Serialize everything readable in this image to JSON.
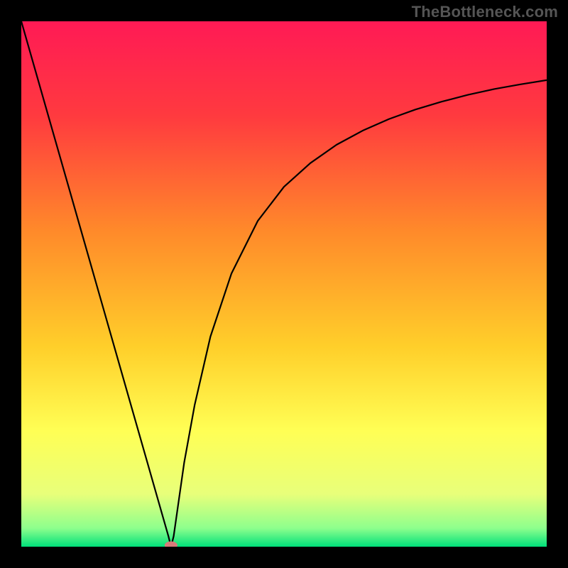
{
  "watermark": "TheBottleneck.com",
  "chart_data": {
    "type": "line",
    "title": "",
    "xlabel": "",
    "ylabel": "",
    "xlim": [
      0,
      100
    ],
    "ylim": [
      0,
      100
    ],
    "grid": false,
    "series": [
      {
        "name": "bottleneck-curve",
        "x": [
          0,
          3,
          6,
          9,
          12,
          15,
          18,
          21,
          24,
          26,
          27,
          28,
          28.5,
          29,
          30,
          31,
          33,
          36,
          40,
          45,
          50,
          55,
          60,
          65,
          70,
          75,
          80,
          85,
          90,
          95,
          100
        ],
        "values": [
          100,
          89.5,
          79,
          68.5,
          58,
          47.5,
          37,
          26.5,
          16,
          9,
          5.5,
          2,
          0,
          2,
          9,
          16,
          27,
          40,
          52,
          62,
          68.5,
          73,
          76.5,
          79.2,
          81.4,
          83.2,
          84.7,
          86,
          87.1,
          88,
          88.8
        ]
      }
    ],
    "annotations": [
      {
        "name": "minimum-marker",
        "x": 28.5,
        "y": 0,
        "shape": "ellipse"
      }
    ],
    "background_gradient": {
      "top": "#ff1a55",
      "stops": [
        {
          "offset": 0.0,
          "color": "#ff1a55"
        },
        {
          "offset": 0.18,
          "color": "#ff3a3f"
        },
        {
          "offset": 0.4,
          "color": "#ff8a2a"
        },
        {
          "offset": 0.62,
          "color": "#ffcf2a"
        },
        {
          "offset": 0.78,
          "color": "#ffff55"
        },
        {
          "offset": 0.9,
          "color": "#e8ff7a"
        },
        {
          "offset": 0.965,
          "color": "#8dff8d"
        },
        {
          "offset": 1.0,
          "color": "#00e07a"
        }
      ]
    }
  }
}
